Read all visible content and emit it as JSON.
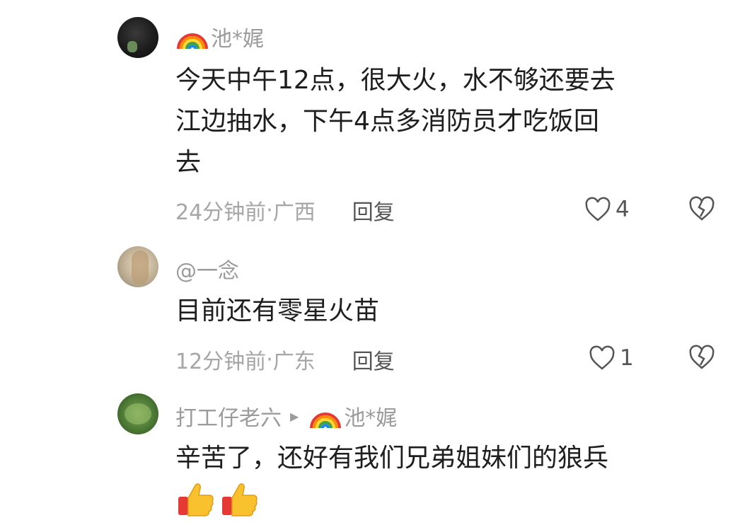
{
  "comments": [
    {
      "username": "池*娓",
      "text": "今天中午12点，很大火，水不够还要去\n江边抽水，下午4点多消防员才吃饭回\n去",
      "time": "24分钟前",
      "location": "广西",
      "reply_label": "回复",
      "likes": "4",
      "avatar_icon": "avatar-dark-icon",
      "name_badge_icon": "rainbow-icon"
    },
    {
      "username": "@一念",
      "text": "目前还有零星火苗",
      "time": "12分钟前",
      "location": "广东",
      "reply_label": "回复",
      "likes": "1",
      "avatar_icon": "avatar-light-icon"
    },
    {
      "username": "打工仔老六",
      "reply_to": "池*娓",
      "text": "辛苦了，还好有我们兄弟姐妹们的狼兵",
      "emojis": [
        "👍",
        "👍"
      ],
      "avatar_icon": "avatar-green-icon",
      "reply_badge_icon": "rainbow-icon"
    }
  ],
  "meta_separator": " · ",
  "colors": {
    "text": "#1e1e1e",
    "muted": "#9b9b9b"
  }
}
